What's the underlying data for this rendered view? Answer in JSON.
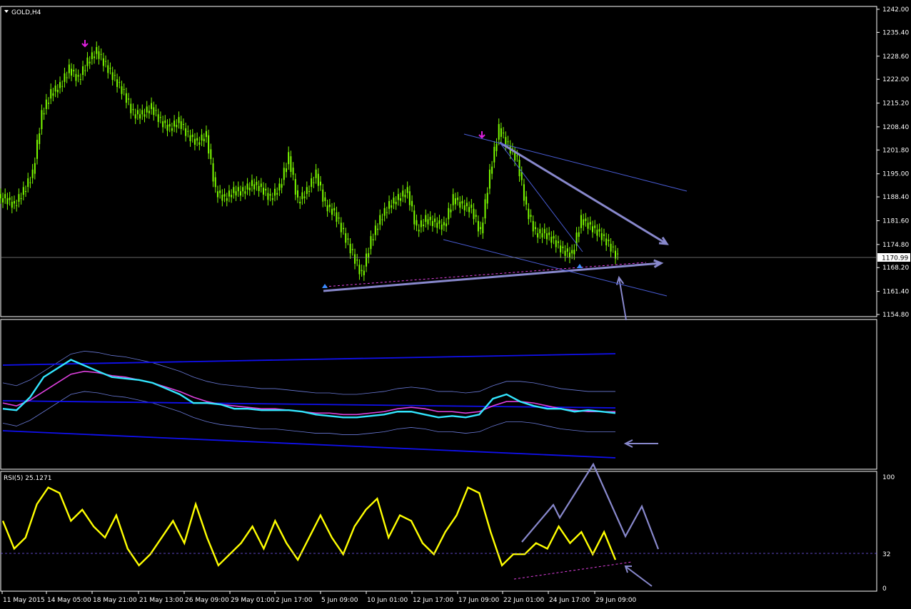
{
  "symbol_label": "GOLD,H4",
  "indicator_label": "RSI(5) 25.1271",
  "current_price": "1170.99",
  "colors": {
    "background": "#000000",
    "grid_border": "#ffffff",
    "candles": "#7CFC00",
    "arrow_marker": "#e020e0",
    "trend_arrows": "#8888cc",
    "bollinger_line": "#33e6ff",
    "ma_line": "#e040e0",
    "envelope_bands": "#1010ee",
    "rsi_line": "#ffff00",
    "rsi_level": "#7a5cff"
  },
  "chart_data": [
    {
      "type": "candlestick",
      "title": "GOLD,H4",
      "price_axis_ticks": [
        "1242.00",
        "1235.40",
        "1228.60",
        "1222.00",
        "1215.20",
        "1208.40",
        "1201.80",
        "1195.00",
        "1188.40",
        "1181.60",
        "1174.80",
        "1168.20",
        "1161.40",
        "1154.80"
      ],
      "ylim": [
        1154.8,
        1242.0
      ],
      "current_price": 1170.99,
      "close_series": [
        1188,
        1186,
        1190,
        1195,
        1212,
        1218,
        1220,
        1225,
        1222,
        1227,
        1230,
        1226,
        1222,
        1218,
        1212,
        1212,
        1214,
        1210,
        1208,
        1210,
        1206,
        1204,
        1206,
        1190,
        1188,
        1190,
        1190,
        1192,
        1191,
        1188,
        1191,
        1200,
        1187,
        1190,
        1195,
        1186,
        1184,
        1178,
        1172,
        1166,
        1176,
        1182,
        1186,
        1188,
        1190,
        1179,
        1182,
        1181,
        1180,
        1188,
        1186,
        1185,
        1178,
        1195,
        1208,
        1203,
        1199,
        1185,
        1178,
        1178,
        1176,
        1173,
        1172,
        1182,
        1180,
        1178,
        1175,
        1171
      ]
    },
    {
      "type": "line",
      "title": "",
      "series": [
        {
          "values": [
            40,
            39,
            48,
            62,
            68,
            74,
            70,
            66,
            62,
            61,
            60,
            58,
            54,
            50,
            44,
            44,
            43,
            40,
            40,
            39,
            39,
            39,
            38,
            36,
            35,
            34,
            34,
            35,
            36,
            38,
            38,
            36,
            34,
            35,
            34,
            36,
            47,
            50,
            45,
            42,
            40,
            40,
            38,
            39,
            38,
            37
          ]
        },
        {
          "values": [
            44,
            42,
            46,
            52,
            58,
            64,
            66,
            65,
            63,
            62,
            60,
            58,
            55,
            52,
            48,
            45,
            43,
            42,
            41,
            40,
            40,
            39,
            38,
            37,
            37,
            36,
            36,
            37,
            38,
            40,
            41,
            40,
            38,
            38,
            37,
            38,
            42,
            45,
            45,
            44,
            42,
            40,
            39,
            38,
            38,
            38
          ]
        }
      ]
    },
    {
      "type": "line",
      "title": "RSI(5) 25.1271",
      "y_ticks": [
        "100",
        "32",
        "0"
      ],
      "ylim": [
        0,
        100
      ],
      "level": 32,
      "series": [
        {
          "values": [
            60,
            35,
            45,
            75,
            90,
            85,
            60,
            70,
            55,
            45,
            65,
            35,
            20,
            30,
            45,
            60,
            40,
            75,
            45,
            20,
            30,
            40,
            55,
            35,
            60,
            40,
            25,
            45,
            65,
            45,
            30,
            55,
            70,
            80,
            45,
            65,
            60,
            40,
            30,
            50,
            65,
            90,
            85,
            50,
            20,
            30,
            30,
            40,
            35,
            55,
            40,
            50,
            30,
            50,
            25
          ]
        }
      ]
    }
  ],
  "x_axis_labels": [
    "11 May 2015",
    "14 May 05:00",
    "18 May 21:00",
    "21 May 13:00",
    "26 May 09:00",
    "29 May 01:00",
    "2 Jun 17:00",
    "5 Jun 09:00",
    "10 Jun 01:00",
    "12 Jun 17:00",
    "17 Jun 09:00",
    "22 Jun 01:00",
    "24 Jun 17:00",
    "29 Jun 09:00"
  ]
}
